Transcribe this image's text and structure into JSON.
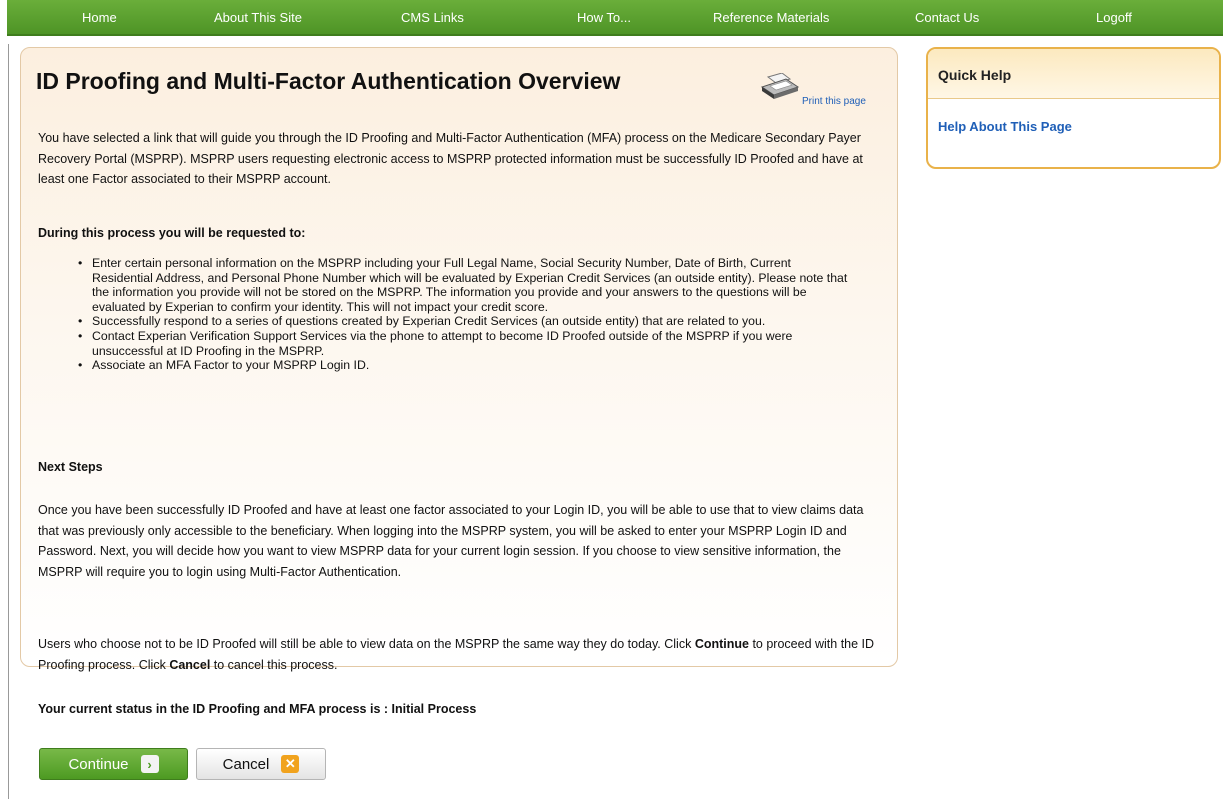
{
  "nav": {
    "items": [
      "Home",
      "About This Site",
      "CMS Links",
      "How To...",
      "Reference Materials",
      "Contact Us",
      "Logoff"
    ]
  },
  "main": {
    "title": "ID Proofing and Multi-Factor Authentication Overview",
    "print_link": "Print this page",
    "intro": "You have selected a link that will guide you through the ID Proofing and Multi-Factor Authentication (MFA) process on the Medicare Secondary Payer Recovery Portal (MSPRP). MSPRP users requesting electronic access to MSPRP protected information must be successfully ID Proofed and have at least one Factor associated to their MSPRP account.",
    "requested_heading": "During this process you will be requested to:",
    "steps": [
      "Enter certain personal information on the MSPRP including your Full Legal Name, Social Security Number, Date of Birth, Current Residential Address, and Personal Phone Number which will be evaluated by Experian Credit Services (an outside entity). Please note that the information you provide will not be stored on the MSPRP. The information you provide and your answers to the questions will be evaluated by Experian to confirm your identity. This will not impact your credit score.",
      "Successfully respond to a series of questions created by Experian Credit Services (an outside entity) that are related to you.",
      "Contact Experian Verification Support Services via the phone to attempt to become ID Proofed outside of the MSPRP if you were unsuccessful at ID Proofing in the MSPRP.",
      "Associate an MFA Factor to your MSPRP Login ID."
    ],
    "next_steps_heading": "Next Steps",
    "next_steps_text": "Once you have been successfully ID Proofed and have at least one factor associated to your Login ID, you will be able to use that to view claims data that was previously only accessible to the beneficiary. When logging into the MSPRP system, you will be asked to enter your MSPRP Login ID and Password. Next, you will decide how you want to view MSPRP data for your current login session. If you choose to view sensitive information, the MSPRP will require you to login using Multi-Factor Authentication.",
    "choose_text_1": "Users who choose not to be ID Proofed will still be able to view data on the MSPRP the same way they do today. Click ",
    "choose_bold_1": "Continue",
    "choose_text_2": " to proceed with the ID Proofing process. Click ",
    "choose_bold_2": "Cancel",
    "choose_text_3": " to cancel this process.",
    "status_text": "Your current status in the ID Proofing and MFA process is : Initial Process"
  },
  "buttons": {
    "continue_label": "Continue",
    "cancel_label": "Cancel"
  },
  "quick_help": {
    "title": "Quick Help",
    "link": "Help About This Page"
  },
  "colors": {
    "nav_green": "#4e9426",
    "link_blue": "#1f5fb7",
    "quick_help_border": "#e9b24a",
    "cancel_icon_orange": "#f1a31e"
  }
}
